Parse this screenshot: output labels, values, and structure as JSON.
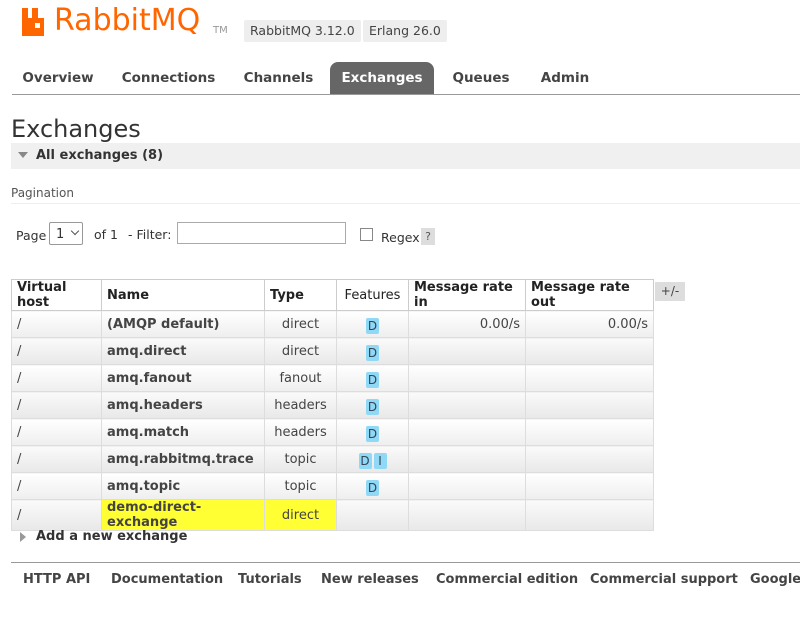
{
  "header": {
    "brand": "RabbitMQ",
    "tm": "TM",
    "version_rabbit": "RabbitMQ 3.12.0",
    "version_erlang": "Erlang 26.0"
  },
  "tabs": [
    "Overview",
    "Connections",
    "Channels",
    "Exchanges",
    "Queues",
    "Admin"
  ],
  "active_tab": "Exchanges",
  "page_title": "Exchanges",
  "section_title": "All exchanges (8)",
  "pagination": {
    "label": "Pagination",
    "page_label": "Page",
    "page_value": "1",
    "of_label": "of 1",
    "filter_label": "- Filter:",
    "filter_value": "",
    "regex_label": "Regex",
    "help": "?"
  },
  "table": {
    "headers": [
      "Virtual host",
      "Name",
      "Type",
      "Features",
      "Message rate in",
      "Message rate out"
    ],
    "plus_minus": "+/-",
    "rows": [
      {
        "vhost": "/",
        "name": "(AMQP default)",
        "type": "direct",
        "features": [
          "D"
        ],
        "rate_in": "0.00/s",
        "rate_out": "0.00/s"
      },
      {
        "vhost": "/",
        "name": "amq.direct",
        "type": "direct",
        "features": [
          "D"
        ],
        "rate_in": "",
        "rate_out": ""
      },
      {
        "vhost": "/",
        "name": "amq.fanout",
        "type": "fanout",
        "features": [
          "D"
        ],
        "rate_in": "",
        "rate_out": ""
      },
      {
        "vhost": "/",
        "name": "amq.headers",
        "type": "headers",
        "features": [
          "D"
        ],
        "rate_in": "",
        "rate_out": ""
      },
      {
        "vhost": "/",
        "name": "amq.match",
        "type": "headers",
        "features": [
          "D"
        ],
        "rate_in": "",
        "rate_out": ""
      },
      {
        "vhost": "/",
        "name": "amq.rabbitmq.trace",
        "type": "topic",
        "features": [
          "D",
          "I"
        ],
        "rate_in": "",
        "rate_out": ""
      },
      {
        "vhost": "/",
        "name": "amq.topic",
        "type": "topic",
        "features": [
          "D"
        ],
        "rate_in": "",
        "rate_out": ""
      },
      {
        "vhost": "/",
        "name": "demo-direct-exchange",
        "type": "direct",
        "features": [],
        "rate_in": "",
        "rate_out": "",
        "highlighted": true
      }
    ]
  },
  "add_exchange": "Add a new exchange",
  "footer": [
    "HTTP API",
    "Documentation",
    "Tutorials",
    "New releases",
    "Commercial edition",
    "Commercial support",
    "Google"
  ],
  "colors": {
    "brand": "#ff6600",
    "active_tab": "#666666",
    "badge": "#8fd8f6",
    "highlight": "#ffff33"
  }
}
